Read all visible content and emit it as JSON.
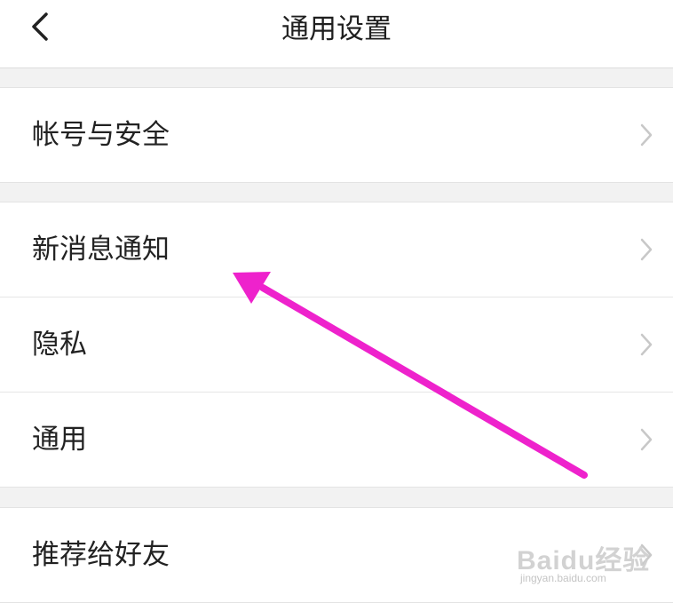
{
  "header": {
    "title": "通用设置"
  },
  "groups": [
    {
      "items": [
        {
          "label": "帐号与安全"
        }
      ]
    },
    {
      "items": [
        {
          "label": "新消息通知"
        },
        {
          "label": "隐私"
        },
        {
          "label": "通用"
        }
      ]
    },
    {
      "items": [
        {
          "label": "推荐给好友"
        }
      ]
    }
  ],
  "watermark": {
    "brand": "Baidu经验",
    "url": "jingyan.baidu.com"
  },
  "icons": {
    "back": "chevron-left-icon",
    "row_chevron": "chevron-right-icon",
    "annotation": "arrow-annotation"
  },
  "colors": {
    "background": "#f2f2f2",
    "surface": "#ffffff",
    "text": "#222222",
    "chevron": "#c8c8c8",
    "annotation_arrow": "#ee22cc"
  }
}
